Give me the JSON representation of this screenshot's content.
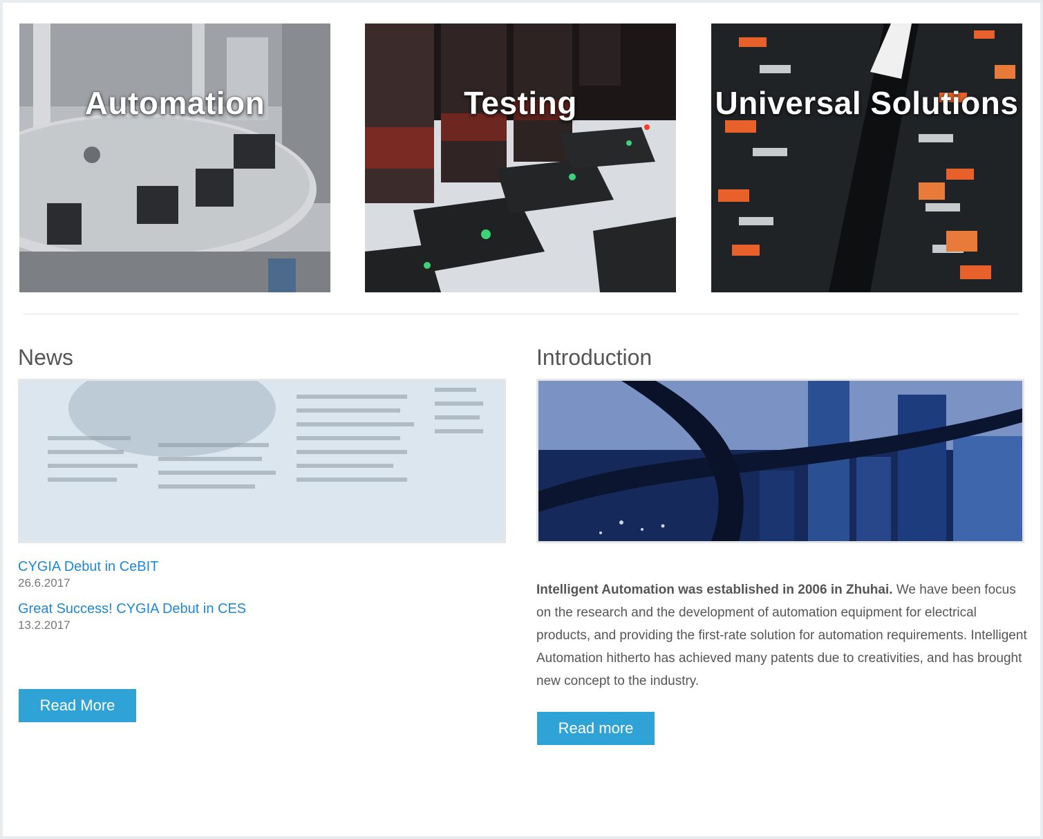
{
  "tiles": [
    {
      "title": "Automation"
    },
    {
      "title": "Testing"
    },
    {
      "title": "Universal Solutions"
    }
  ],
  "news": {
    "heading": "News",
    "items": [
      {
        "title": "CYGIA Debut in CeBIT",
        "date": "26.6.2017"
      },
      {
        "title": "Great Success! CYGIA Debut in CES",
        "date": "13.2.2017"
      }
    ],
    "button_label": "Read More"
  },
  "intro": {
    "heading": "Introduction",
    "lead": "Intelligent Automation was established in 2006 in Zhuhai.",
    "body": " We have been focus on the research and the development of automation equipment for electrical products, and providing the first-rate solution for automation requirements. Intelligent Automation hitherto has achieved many patents due to creativities, and has brought new concept to the industry.",
    "button_label": "Read more"
  },
  "colors": {
    "accent": "#2fa3d6",
    "link": "#1e88d6"
  }
}
